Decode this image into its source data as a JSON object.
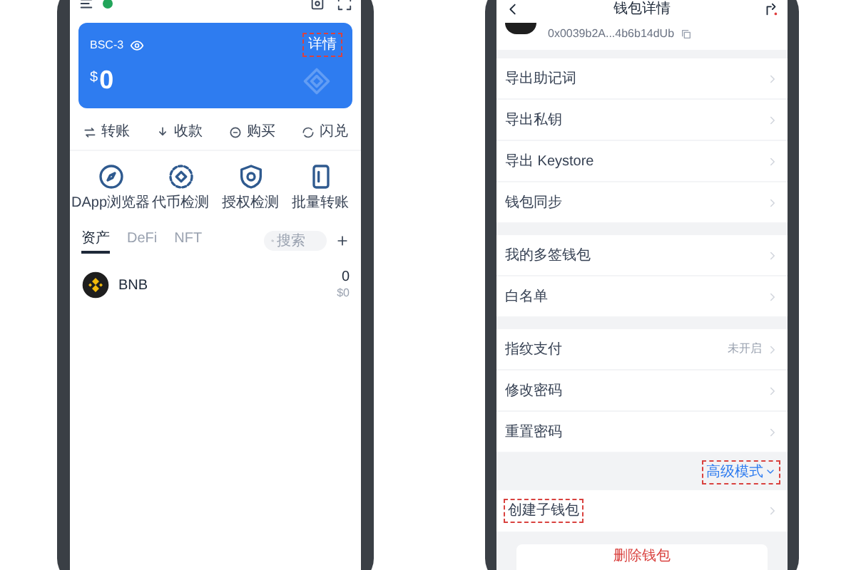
{
  "left_phone": {
    "card": {
      "network": "BSC-3",
      "currency": "$",
      "balance": "0",
      "detail_link": {
        "label": "详情",
        "highlighted": true
      }
    },
    "actions": [
      {
        "kind": "transfer",
        "label": "转账"
      },
      {
        "kind": "receive",
        "label": "收款"
      },
      {
        "kind": "buy",
        "label": "购买"
      },
      {
        "kind": "swap",
        "label": "闪兑"
      }
    ],
    "tools": [
      {
        "kind": "compass",
        "label": "DApp浏览器"
      },
      {
        "kind": "token",
        "label": "代币检测"
      },
      {
        "kind": "shield",
        "label": "授权检测"
      },
      {
        "kind": "batch",
        "label": "批量转账"
      }
    ],
    "tabs": [
      {
        "label": "资产",
        "selected": true
      },
      {
        "label": "DeFi",
        "selected": false
      },
      {
        "label": "NFT",
        "selected": false
      }
    ],
    "search": {
      "placeholder": "搜索"
    },
    "assets": [
      {
        "symbol": "BNB",
        "amount": "0",
        "value": "$0"
      }
    ]
  },
  "right_phone": {
    "title": "钱包详情",
    "address": "0x0039b2A...4b6b14dUb",
    "groups": [
      [
        {
          "label": "导出助记词"
        },
        {
          "label": "导出私钥"
        },
        {
          "label": "导出 Keystore"
        },
        {
          "label": "钱包同步"
        }
      ],
      [
        {
          "label": "我的多签钱包"
        },
        {
          "label": "白名单"
        }
      ],
      [
        {
          "label": "指纹支付",
          "value": "未开启"
        },
        {
          "label": "修改密码"
        },
        {
          "label": "重置密码"
        }
      ]
    ],
    "advanced": {
      "label": "高级模式",
      "highlighted": true
    },
    "create_sub_wallet": {
      "label": "创建子钱包",
      "highlighted": true
    },
    "delete_button": "删除钱包"
  }
}
